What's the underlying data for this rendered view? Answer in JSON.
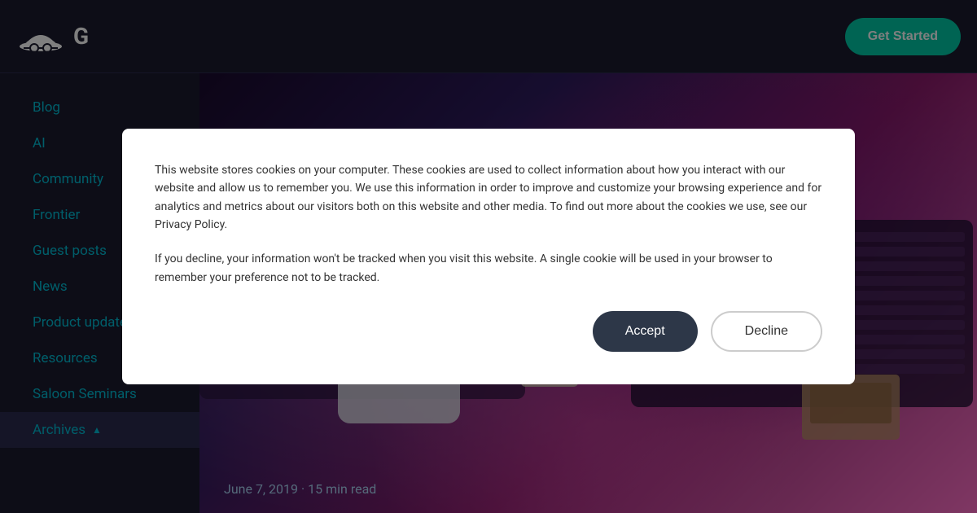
{
  "header": {
    "logo_text": "G",
    "get_started_label": "Get Started"
  },
  "sidebar": {
    "items": [
      {
        "label": "Blog",
        "active": false
      },
      {
        "label": "AI",
        "active": false
      },
      {
        "label": "Community",
        "active": false
      },
      {
        "label": "Frontier",
        "active": false
      },
      {
        "label": "Guest posts",
        "active": false
      },
      {
        "label": "News",
        "active": false
      },
      {
        "label": "Product updates",
        "active": false
      },
      {
        "label": "Resources",
        "active": false
      },
      {
        "label": "Saloon Seminars",
        "active": false
      },
      {
        "label": "Archives",
        "active": true,
        "chevron": "▲"
      }
    ]
  },
  "hero": {
    "date": "June 7, 2019 · 15 min read"
  },
  "modal": {
    "paragraph1": "This website stores cookies on your computer. These cookies are used to collect information about how you interact with our website and allow us to remember you. We use this information in order to improve and customize your browsing experience and for analytics and metrics about our visitors both on this website and other media. To find out more about the cookies we use, see our Privacy Policy.",
    "paragraph2": "If you decline, your information won't be tracked when you visit this website. A single cookie will be used in your browser to remember your preference not to be tracked.",
    "accept_label": "Accept",
    "decline_label": "Decline",
    "privacy_policy_label": "Privacy Policy"
  }
}
